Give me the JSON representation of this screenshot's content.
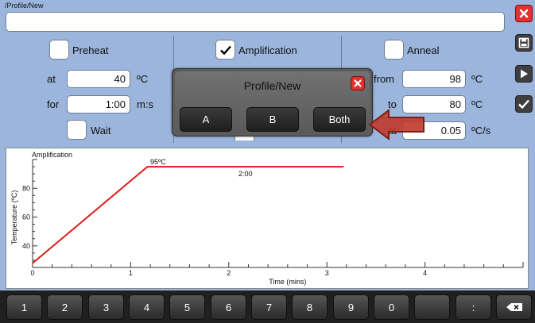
{
  "header": {
    "path": "/Profile/New",
    "name_value": ""
  },
  "side_buttons": [
    {
      "name": "close-icon"
    },
    {
      "name": "save-icon"
    },
    {
      "name": "play-icon"
    },
    {
      "name": "check-icon"
    }
  ],
  "preheat": {
    "label": "Preheat",
    "checked": false,
    "at_label": "at",
    "at_value": "40",
    "at_unit": "ºC",
    "for_label": "for",
    "for_value": "1:00",
    "for_unit": "m:s",
    "wait_label": "Wait"
  },
  "amplification": {
    "label": "Amplification",
    "checked": true
  },
  "anneal": {
    "label": "Anneal",
    "checked": false,
    "from_label": "from",
    "from_value": "98",
    "from_unit": "ºC",
    "to_label": "to",
    "to_value": "80",
    "to_unit": "ºC",
    "at_label": "at",
    "at_value": "0.05",
    "at_unit": "ºC/s"
  },
  "dialog": {
    "title": "Profile/New",
    "buttons": [
      "A",
      "B",
      "Both"
    ]
  },
  "chart_data": {
    "type": "line",
    "title": "Amplification",
    "xlabel": "Time (mins)",
    "ylabel": "Temperature (ºC)",
    "xlim": [
      0,
      5
    ],
    "ylim": [
      25,
      100
    ],
    "x_ticks": [
      "0",
      "1",
      "2",
      "3",
      "4"
    ],
    "y_ticks": [
      "40",
      "60",
      "80"
    ],
    "series": [
      {
        "points": [
          [
            0,
            28
          ],
          [
            1.17,
            95
          ],
          [
            3.17,
            95
          ]
        ]
      }
    ],
    "annotations": [
      {
        "text": "95ºC",
        "x": 1.28,
        "y": 95
      },
      {
        "text": "2:00",
        "x": 2.17,
        "y": 95
      }
    ],
    "color": "#e01a1a"
  },
  "keypad": [
    "1",
    "2",
    "3",
    "4",
    "5",
    "6",
    "7",
    "8",
    "9",
    "0",
    "",
    ":",
    "backspace"
  ]
}
